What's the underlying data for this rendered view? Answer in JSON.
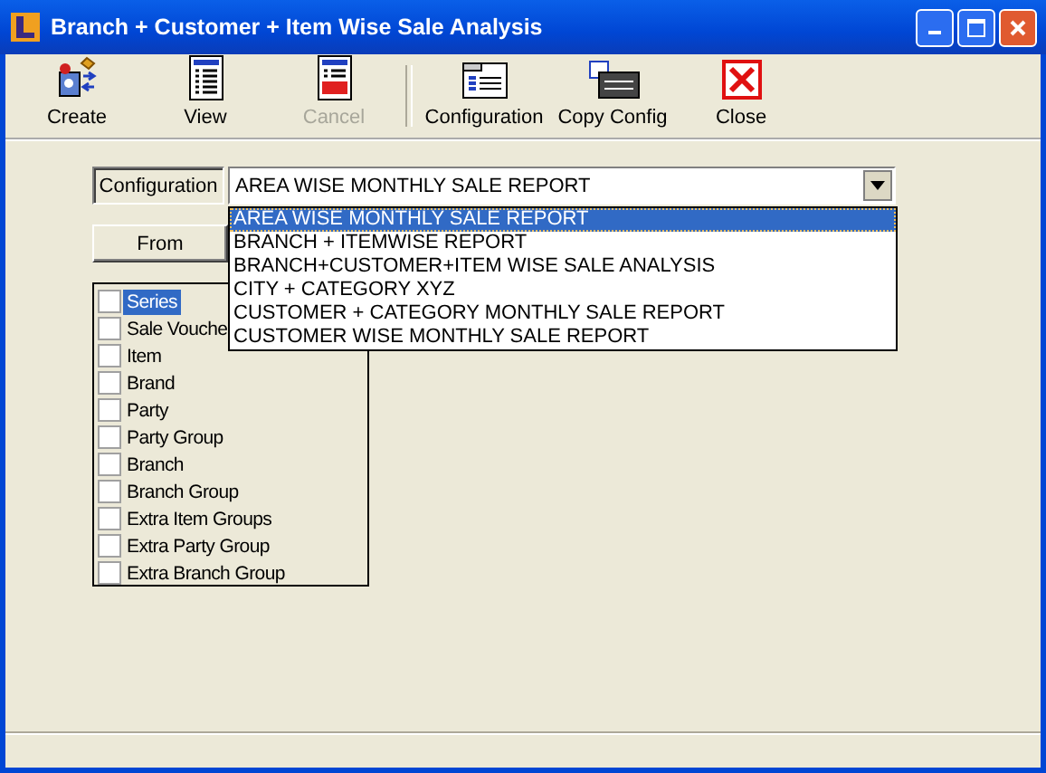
{
  "window": {
    "title": "Branch + Customer + Item Wise Sale Analysis"
  },
  "toolbar": [
    {
      "kind": "create",
      "label": "Create",
      "disabled": false
    },
    {
      "kind": "view",
      "label": "View",
      "disabled": false
    },
    {
      "kind": "cancel",
      "label": "Cancel",
      "disabled": true
    },
    {
      "kind": "separator"
    },
    {
      "kind": "configuration",
      "label": "Configuration",
      "disabled": false
    },
    {
      "kind": "copy",
      "label": "Copy Config",
      "disabled": false
    },
    {
      "kind": "close",
      "label": "Close",
      "disabled": false
    }
  ],
  "configuration": {
    "label": "Configuration",
    "value": "AREA WISE MONTHLY SALE REPORT",
    "expanded": true,
    "options": [
      {
        "label": "AREA WISE MONTHLY SALE REPORT",
        "selected": true
      },
      {
        "label": "BRANCH + ITEMWISE REPORT",
        "selected": false
      },
      {
        "label": "BRANCH+CUSTOMER+ITEM WISE SALE ANALYSIS",
        "selected": false
      },
      {
        "label": "CITY + CATEGORY XYZ",
        "selected": false
      },
      {
        "label": "CUSTOMER + CATEGORY MONTHLY SALE REPORT",
        "selected": false
      },
      {
        "label": "CUSTOMER WISE MONTHLY SALE REPORT",
        "selected": false
      }
    ]
  },
  "from_button": {
    "label": "From"
  },
  "fields": [
    {
      "label": "Series",
      "checked": false,
      "selected": true
    },
    {
      "label": "Sale Vouche",
      "checked": false,
      "selected": false
    },
    {
      "label": "Item",
      "checked": false,
      "selected": false
    },
    {
      "label": "Brand",
      "checked": false,
      "selected": false
    },
    {
      "label": "Party",
      "checked": false,
      "selected": false
    },
    {
      "label": "Party Group",
      "checked": false,
      "selected": false
    },
    {
      "label": "Branch",
      "checked": false,
      "selected": false
    },
    {
      "label": "Branch Group",
      "checked": false,
      "selected": false
    },
    {
      "label": "Extra Item Groups",
      "checked": false,
      "selected": false
    },
    {
      "label": "Extra Party Group",
      "checked": false,
      "selected": false
    },
    {
      "label": "Extra Branch Group",
      "checked": false,
      "selected": false
    }
  ]
}
